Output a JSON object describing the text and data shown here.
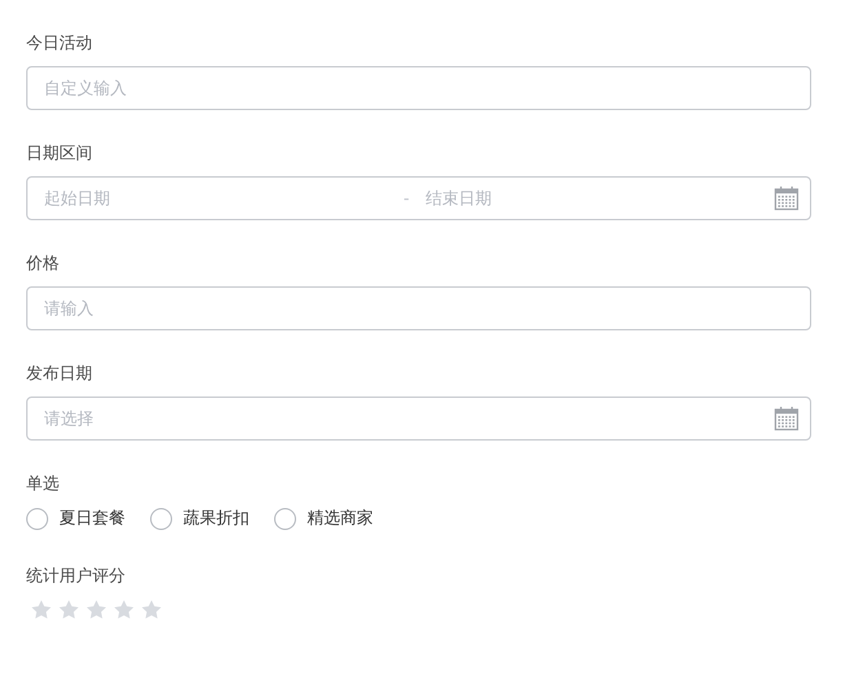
{
  "fields": [
    {
      "kind": "text",
      "label": "今日活动",
      "placeholder": "自定义输入"
    },
    {
      "kind": "range",
      "label": "日期区间",
      "start_placeholder": "起始日期",
      "separator": "-",
      "end_placeholder": "结束日期"
    },
    {
      "kind": "text",
      "label": "价格",
      "placeholder": "请输入"
    },
    {
      "kind": "date",
      "label": "发布日期",
      "placeholder": "请选择"
    },
    {
      "kind": "radio",
      "label": "单选",
      "options": [
        {
          "label": "夏日套餐",
          "selected": false
        },
        {
          "label": "蔬果折扣",
          "selected": false
        },
        {
          "label": "精选商家",
          "selected": false
        }
      ]
    },
    {
      "kind": "rating",
      "label": "统计用户评分",
      "stars": 0
    }
  ]
}
